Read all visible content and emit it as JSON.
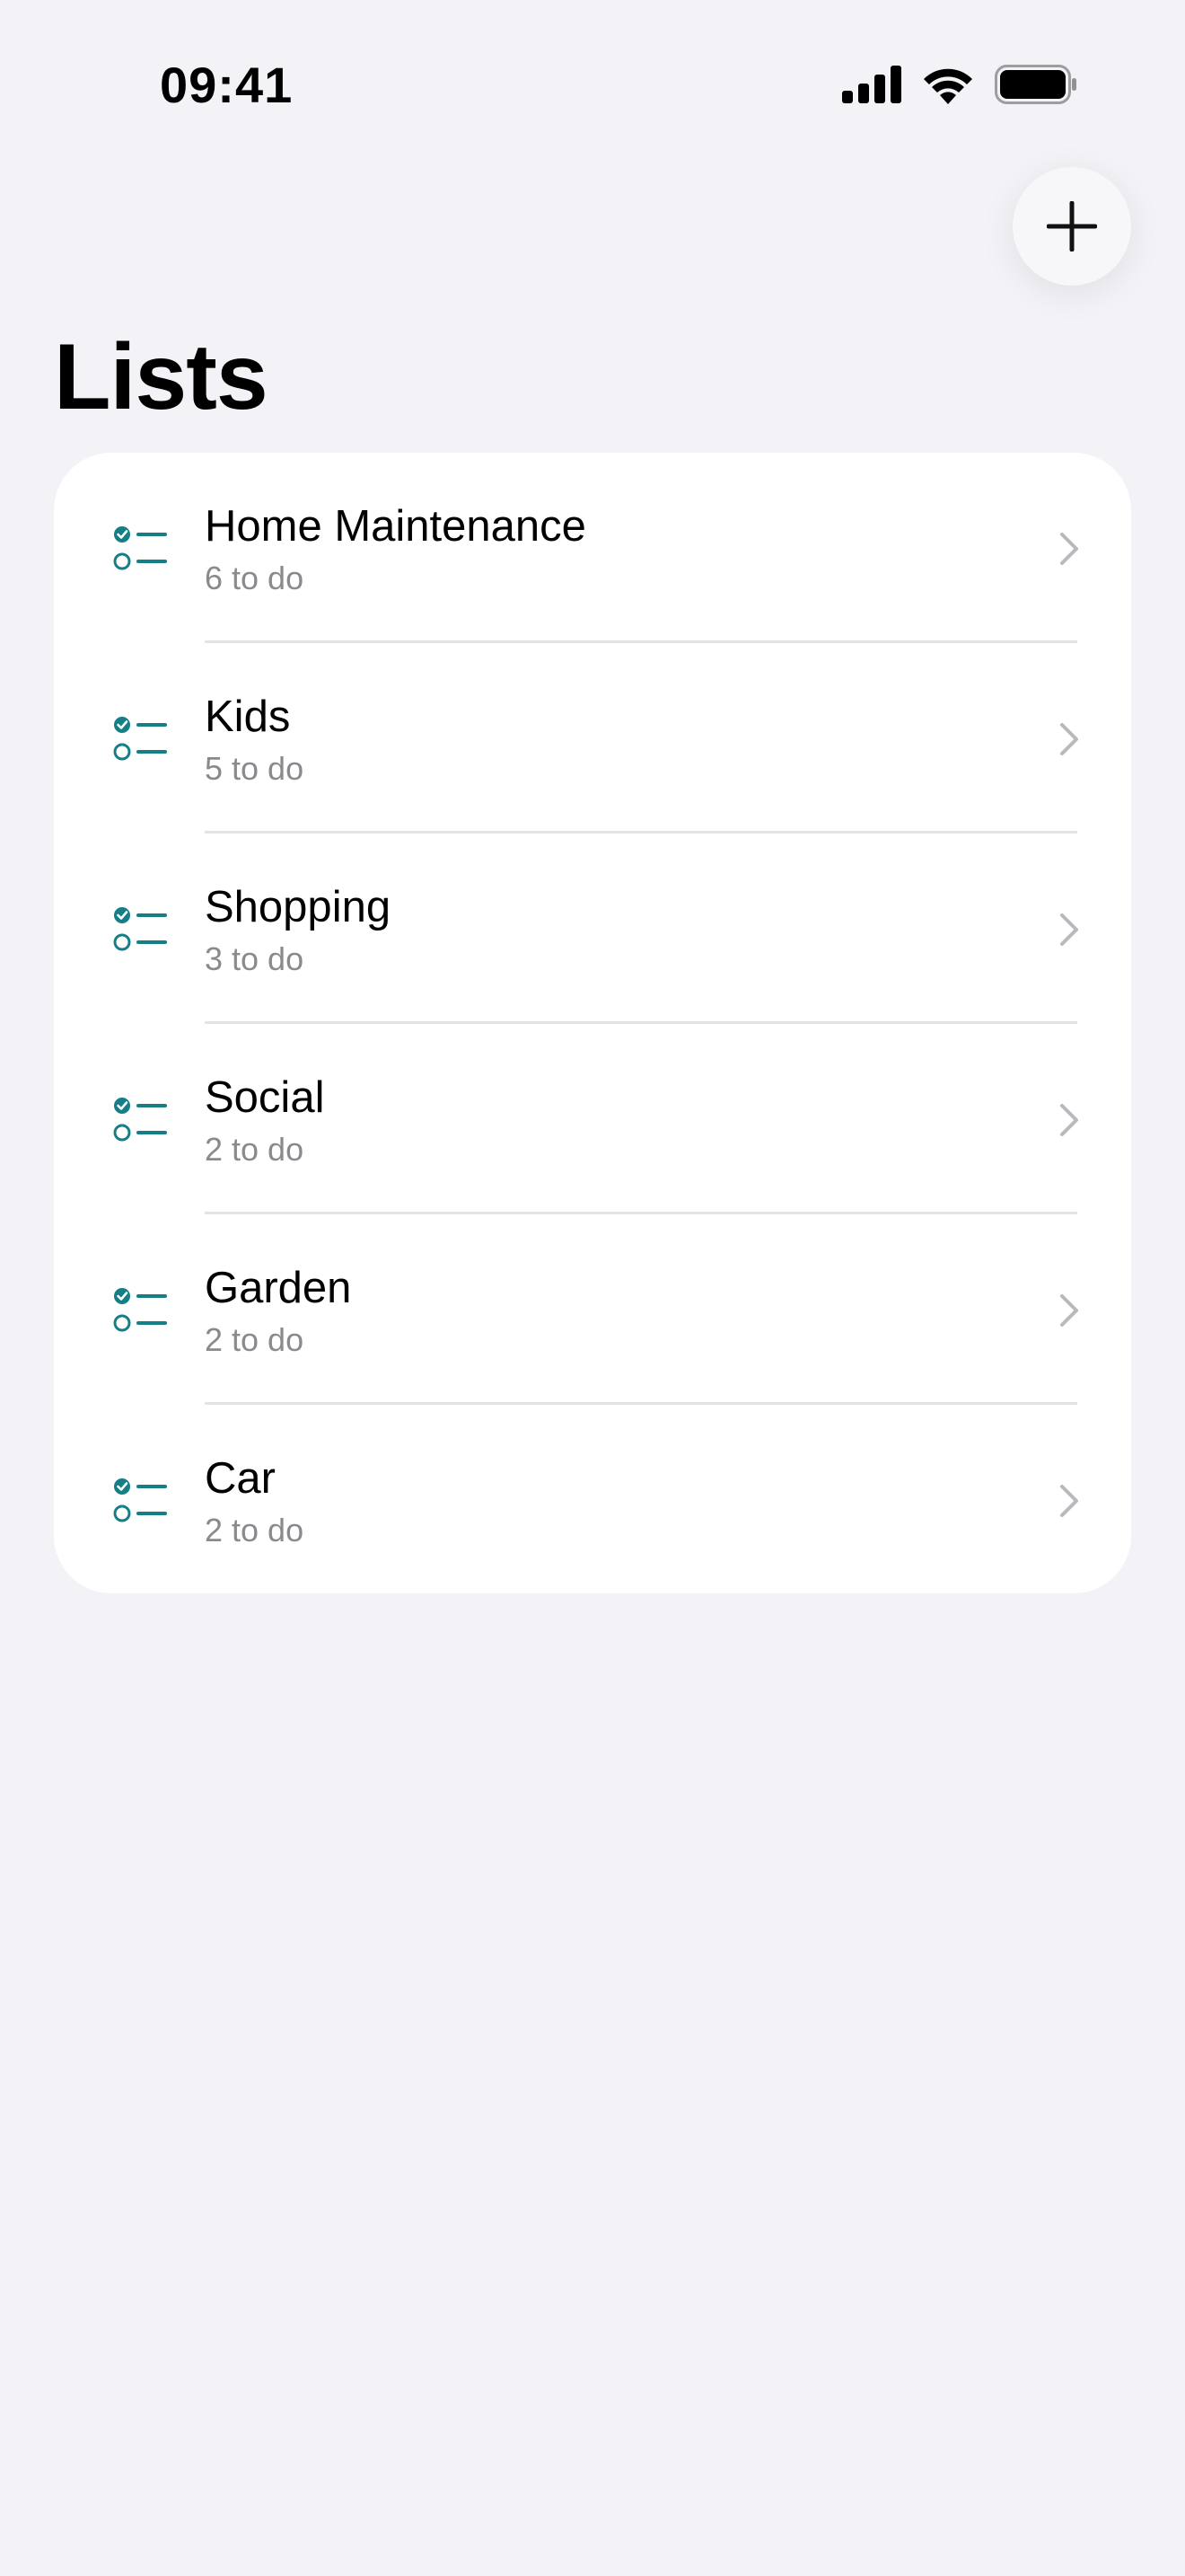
{
  "status_bar": {
    "time": "09:41",
    "icons": [
      "cellular-signal-icon",
      "wifi-icon",
      "battery-icon"
    ]
  },
  "header": {
    "title": "Lists",
    "add_icon": "plus-icon"
  },
  "colors": {
    "accent": "#167e86",
    "background": "#f2f2f7",
    "card": "#ffffff",
    "secondary_text": "#8a8a8e",
    "chevron": "#b9b9bd"
  },
  "lists": [
    {
      "title": "Home Maintenance",
      "subtitle": "6 to do",
      "icon": "checklist-icon"
    },
    {
      "title": "Kids",
      "subtitle": "5 to do",
      "icon": "checklist-icon"
    },
    {
      "title": "Shopping",
      "subtitle": "3 to do",
      "icon": "checklist-icon"
    },
    {
      "title": "Social",
      "subtitle": "2 to do",
      "icon": "checklist-icon"
    },
    {
      "title": "Garden",
      "subtitle": "2 to do",
      "icon": "checklist-icon"
    },
    {
      "title": "Car",
      "subtitle": "2 to do",
      "icon": "checklist-icon"
    }
  ]
}
